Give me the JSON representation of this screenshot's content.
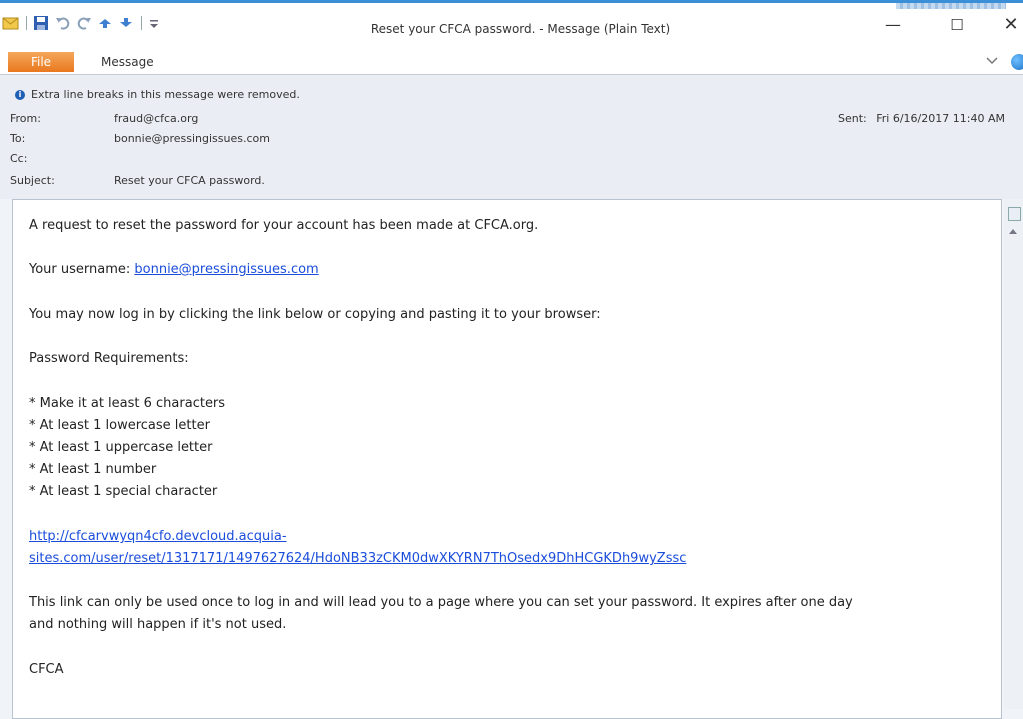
{
  "window": {
    "title": "Reset your CFCA password.  -  Message (Plain Text)",
    "minimize_glyph": "—",
    "maximize_glyph": "☐",
    "close_glyph": "✕"
  },
  "ribbon": {
    "file_label": "File",
    "message_label": "Message"
  },
  "header": {
    "info": "Extra line breaks in this message were removed.",
    "from_label": "From:",
    "from_value": "fraud@cfca.org",
    "to_label": "To:",
    "to_value": "bonnie@pressingissues.com",
    "cc_label": "Cc:",
    "subject_label": "Subject:",
    "subject_value": "Reset your CFCA password.",
    "sent_label": "Sent:",
    "sent_value": "Fri 6/16/2017 11:40 AM"
  },
  "body": {
    "line1": "A request to reset the password for your account has been made at CFCA.org.",
    "username_label": "Your username: ",
    "username_link": "bonnie@pressingissues.com",
    "line3": "You may now log in by clicking the link below or copying and pasting it to your browser:",
    "req_title": "Password Requirements:",
    "requirements": [
      " * Make it at least 6 characters",
      " * At least 1 lowercase letter",
      " * At least 1 uppercase letter",
      " * At least 1 number",
      " * At least 1 special character"
    ],
    "link_line1": "http://cfcarvwyqn4cfo.devcloud.acquia-",
    "link_line2": "sites.com/user/reset/1317171/1497627624/HdoNB33zCKM0dwXKYRN7ThOsedx9DhHCGKDh9wyZssc",
    "note_line1": "This link can only be used once to log in and will lead you to a page where you can set your password. It expires after one day",
    "note_line2": "and nothing will happen if it's not used.",
    "signature": "CFCA"
  },
  "colors": {
    "file_tab": "#e9781f",
    "link": "#1a4ddb",
    "title_accent": "#3b8fd6"
  }
}
